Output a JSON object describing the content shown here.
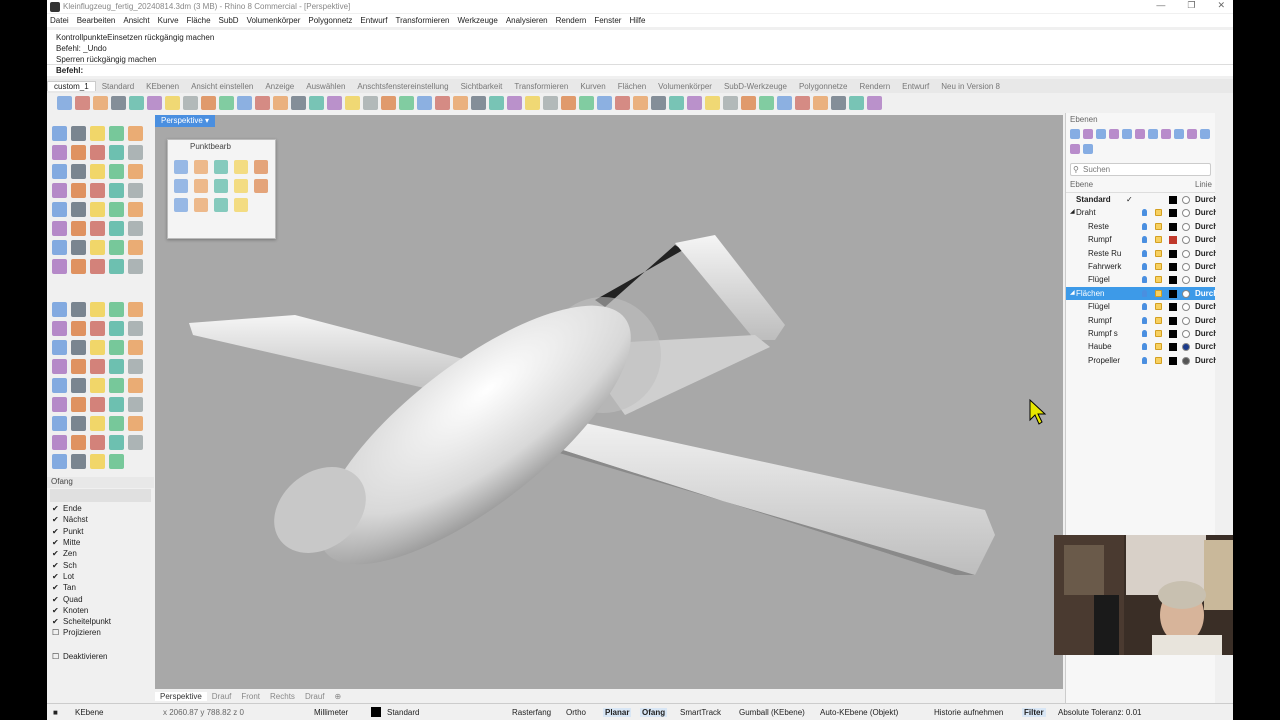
{
  "window": {
    "title": "Kleinflugzeug_fertig_20240814.3dm (3 MB) - Rhino 8 Commercial - [Perspektive]"
  },
  "menu": [
    "Datei",
    "Bearbeiten",
    "Ansicht",
    "Kurve",
    "Fläche",
    "SubD",
    "Volumenkörper",
    "Polygonnetz",
    "Entwurf",
    "Transformieren",
    "Werkzeuge",
    "Analysieren",
    "Rendern",
    "Fenster",
    "Hilfe"
  ],
  "history": [
    "KontrollpunkteEinsetzen rückgängig machen",
    "Befehl: _Undo",
    "Sperren rückgängig machen"
  ],
  "command": {
    "label": "Befehl:"
  },
  "toolbar_tabs": [
    "custom_1",
    "Standard",
    "KEbenen",
    "Ansicht einstellen",
    "Anzeige",
    "Auswählen",
    "Anschtsfenstereinstellung",
    "Sichtbarkeit",
    "Transformieren",
    "Kurven",
    "Flächen",
    "Volumenkörper",
    "SubD-Werkzeuge",
    "Polygonnetze",
    "Rendern",
    "Entwurf",
    "Neu in Version 8"
  ],
  "viewport": {
    "active_label": "Perspektive",
    "bottom_tabs": [
      "Perspektive",
      "Drauf",
      "Front",
      "Rechts",
      "Drauf"
    ]
  },
  "float_panel": {
    "title": "Punktbearb"
  },
  "osnap": {
    "title": "Ofang",
    "items": [
      {
        "label": "Ende",
        "checked": true
      },
      {
        "label": "Nächst",
        "checked": true
      },
      {
        "label": "Punkt",
        "checked": true
      },
      {
        "label": "Mitte",
        "checked": true
      },
      {
        "label": "Zen",
        "checked": true
      },
      {
        "label": "Sch",
        "checked": true
      },
      {
        "label": "Lot",
        "checked": true
      },
      {
        "label": "Tan",
        "checked": true
      },
      {
        "label": "Quad",
        "checked": true
      },
      {
        "label": "Knoten",
        "checked": true
      },
      {
        "label": "Scheitelpunkt",
        "checked": true
      },
      {
        "label": "Projizieren",
        "checked": false
      }
    ],
    "disable_label": "Deaktivieren"
  },
  "layers": {
    "title": "Ebenen",
    "search_placeholder": "Suchen",
    "col_name": "Ebene",
    "col_linetype": "Linie",
    "rows": [
      {
        "name": "Standard",
        "indent": 0,
        "current": true,
        "color": "#000000",
        "linetype": "Durch",
        "material": "#ffffff",
        "bold": true,
        "selected": false
      },
      {
        "name": "Draht",
        "indent": 1,
        "expander": "◢",
        "color": "#000000",
        "linetype": "Durch",
        "material": "#ffffff",
        "selected": false
      },
      {
        "name": "Reste",
        "indent": 2,
        "color": "#000000",
        "linetype": "Durch",
        "material": "#ffffff",
        "selected": false
      },
      {
        "name": "Rumpf",
        "indent": 2,
        "color": "#c0392b",
        "linetype": "Durch",
        "material": "#ffffff",
        "selected": false
      },
      {
        "name": "Reste Ru",
        "indent": 2,
        "color": "#000000",
        "linetype": "Durch",
        "material": "#ffffff",
        "selected": false
      },
      {
        "name": "Fahrwerk",
        "indent": 2,
        "color": "#000000",
        "linetype": "Durch",
        "material": "#ffffff",
        "selected": false
      },
      {
        "name": "Flügel",
        "indent": 2,
        "color": "#000000",
        "linetype": "Durch",
        "material": "#ffffff",
        "selected": false
      },
      {
        "name": "Flächen",
        "indent": 1,
        "expander": "◢",
        "color": "#000000",
        "linetype": "Durch",
        "material": "#ffffff",
        "selected": true
      },
      {
        "name": "Flügel",
        "indent": 2,
        "color": "#000000",
        "linetype": "Durch",
        "material": "#ffffff",
        "selected": false
      },
      {
        "name": "Rumpf",
        "indent": 2,
        "color": "#000000",
        "linetype": "Durch",
        "material": "#ffffff",
        "selected": false
      },
      {
        "name": "Rumpf s",
        "indent": 2,
        "color": "#000000",
        "linetype": "Durch",
        "material": "#ffffff",
        "selected": false
      },
      {
        "name": "Haube",
        "indent": 2,
        "color": "#000000",
        "linetype": "Durch",
        "material": "#1a3a8a",
        "selected": false
      },
      {
        "name": "Propeller",
        "indent": 2,
        "color": "#000000",
        "linetype": "Durch",
        "material": "#555555",
        "selected": false
      }
    ]
  },
  "status": {
    "cplane": "KEbene",
    "coords": "x 2060.87  y 788.82  z 0",
    "units": "Millimeter",
    "layer": "Standard",
    "toggles": [
      "Rasterfang",
      "Ortho",
      "Planar",
      "Ofang",
      "SmartTrack",
      "Gumball (KEbene)",
      "Auto-KEbene (Objekt)",
      "Historie aufnehmen",
      "Filter"
    ],
    "active_toggles": [
      "Planar",
      "Ofang",
      "Filter"
    ],
    "tolerance": "Absolute Toleranz: 0.01"
  },
  "colors": {
    "accent": "#3d9ae8",
    "viewport_bg": "#a8a8a8",
    "selection": "#3d9ae8"
  }
}
